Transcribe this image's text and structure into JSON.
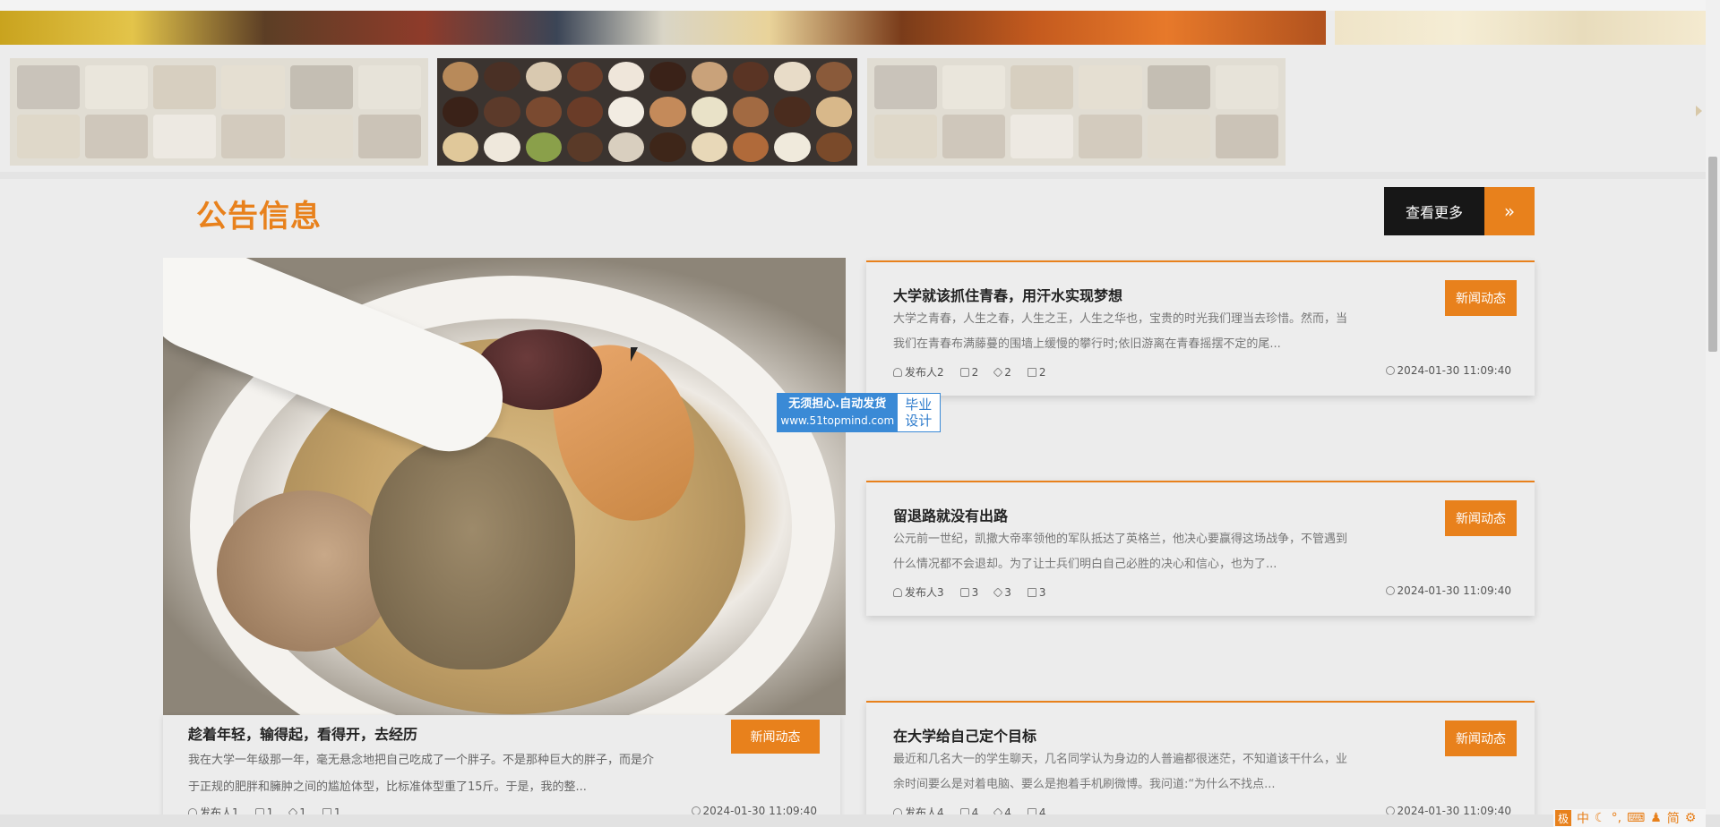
{
  "section": {
    "title": "公告信息",
    "more_label": "查看更多",
    "more_arrow": "»"
  },
  "featured": {
    "title": "趁着年轻，输得起，看得开，去经历",
    "tag": "新闻动态",
    "desc": "我在大学一年级那一年，毫无悬念地把自己吃成了一个胖子。不是那种巨大的胖子，而是介于正规的肥胖和臃肿之间的尴尬体型，比标准体型重了15斤。于是，我的整...",
    "author": "发布人1",
    "likes": "1",
    "stars": "1",
    "comments": "1",
    "date": "2024-01-30 11:09:40"
  },
  "news": [
    {
      "title": "大学就该抓住青春，用汗水实现梦想",
      "tag": "新闻动态",
      "desc": "大学之青春，人生之春，人生之王，人生之华也，宝贵的时光我们理当去珍惜。然而，当我们在青春布满藤蔓的围墙上缓慢的攀行时;依旧游离在青春摇摆不定的尾...",
      "author": "发布人2",
      "likes": "2",
      "stars": "2",
      "comments": "2",
      "date": "2024-01-30 11:09:40"
    },
    {
      "title": "留退路就没有出路",
      "tag": "新闻动态",
      "desc": "公元前一世纪，凯撒大帝率领他的军队抵达了英格兰，他决心要赢得这场战争，不管遇到什么情况都不会退却。为了让士兵们明白自己必胜的决心和信心，也为了...",
      "author": "发布人3",
      "likes": "3",
      "stars": "3",
      "comments": "3",
      "date": "2024-01-30 11:09:40"
    },
    {
      "title": "在大学给自己定个目标",
      "tag": "新闻动态",
      "desc": "最近和几名大一的学生聊天，几名同学认为身边的人普遍都很迷茫，不知道该干什么，业余时间要么是对着电脑、要么是抱着手机刷微博。我问道:“为什么不找点...",
      "author": "发布人4",
      "likes": "4",
      "stars": "4",
      "comments": "4",
      "date": "2024-01-30 11:09:40"
    }
  ],
  "watermark": {
    "line1": "无须担心.自动发货",
    "line2": "www.51topmind.com",
    "right1": "毕业",
    "right2": "设计"
  },
  "ime": {
    "logo": "极",
    "lang": "中",
    "moon": "☾",
    "punct": "°,",
    "keyboard": "⌨",
    "user": "♟",
    "simp": "简",
    "gear": "⚙"
  },
  "colors": {
    "accent": "#e8811c",
    "dark": "#171717"
  }
}
